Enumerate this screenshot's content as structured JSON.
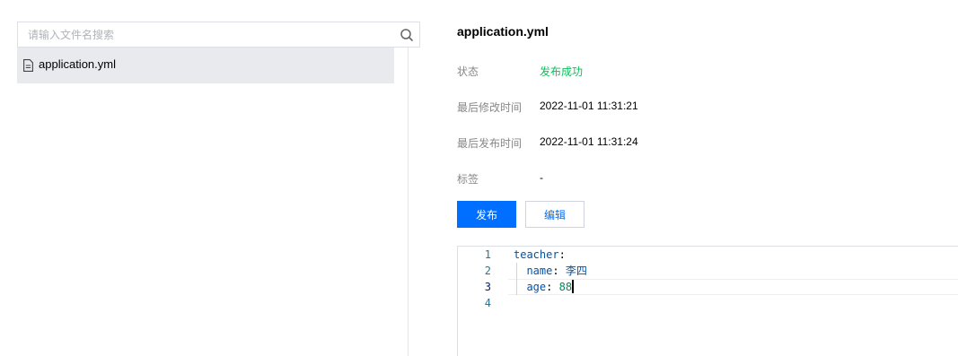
{
  "search": {
    "placeholder": "请输入文件名搜索",
    "value": ""
  },
  "file_list": {
    "items": [
      {
        "name": "application.yml",
        "selected": true,
        "icon": "document-icon"
      }
    ]
  },
  "detail": {
    "title": "application.yml",
    "rows": {
      "status": {
        "label": "状态",
        "value": "发布成功"
      },
      "modified": {
        "label": "最后修改时间",
        "value": "2022-11-01 11:31:21"
      },
      "published": {
        "label": "最后发布时间",
        "value": "2022-11-01 11:31:24"
      },
      "tags": {
        "label": "标签",
        "value": "-"
      }
    },
    "buttons": {
      "publish": "发布",
      "edit": "编辑"
    }
  },
  "editor": {
    "line_numbers": [
      "1",
      "2",
      "3",
      "4"
    ],
    "current_line": 3,
    "tokens": {
      "l1_key": "teacher",
      "l1_colon": ":",
      "l2_key": "name",
      "l2_colon": ":",
      "l2_value": "李四",
      "l3_key": "age",
      "l3_colon": ":",
      "l3_value": "88"
    }
  },
  "colors": {
    "primary": "#006eff",
    "success": "#0abf5b",
    "selected_bg": "#e8eaee"
  }
}
